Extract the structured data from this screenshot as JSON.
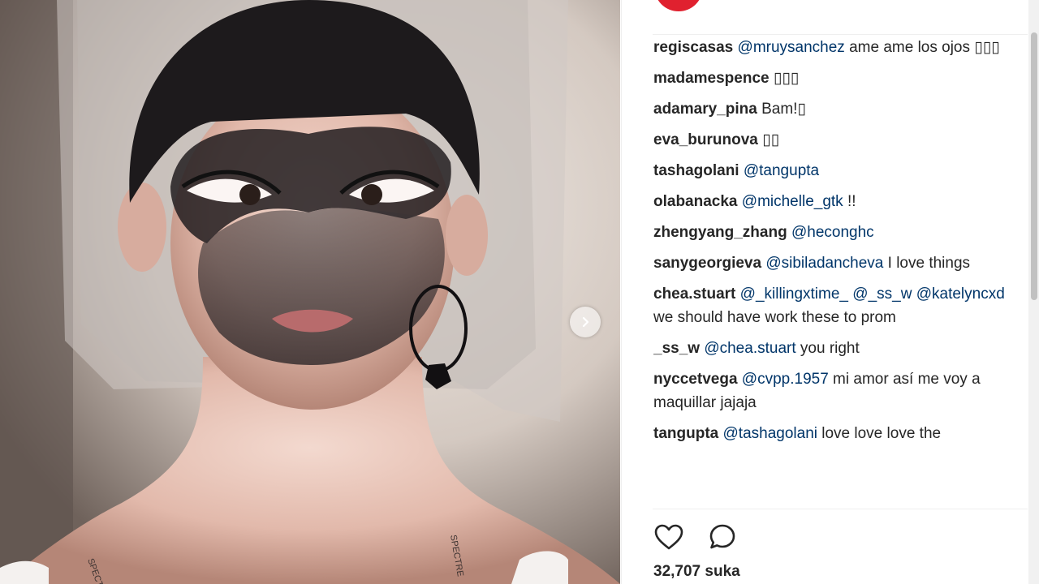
{
  "photo": {
    "alt_subject": "model-with-veil-mask",
    "next_icon": "chevron-right-icon"
  },
  "comments": [
    {
      "username": "regiscasas",
      "parts": [
        {
          "type": "mention",
          "text": "@mruysanchez"
        },
        {
          "type": "text",
          "text": " ame ame los ojos ▯▯▯"
        }
      ]
    },
    {
      "username": "madamespence",
      "parts": [
        {
          "type": "text",
          "text": "▯▯▯"
        }
      ]
    },
    {
      "username": "adamary_pina",
      "parts": [
        {
          "type": "text",
          "text": "Bam!▯"
        }
      ]
    },
    {
      "username": "eva_burunova",
      "parts": [
        {
          "type": "text",
          "text": "▯▯"
        }
      ]
    },
    {
      "username": "tashagolani",
      "parts": [
        {
          "type": "mention",
          "text": "@tangupta"
        }
      ]
    },
    {
      "username": "olabanacka",
      "parts": [
        {
          "type": "mention",
          "text": "@michelle_gtk"
        },
        {
          "type": "text",
          "text": " !!"
        }
      ]
    },
    {
      "username": "zhengyang_zhang",
      "parts": [
        {
          "type": "mention",
          "text": "@hecongh​c"
        }
      ]
    },
    {
      "username": "sanygeorgieva",
      "parts": [
        {
          "type": "mention",
          "text": "@sibiladancheva"
        },
        {
          "type": "text",
          "text": " I love things"
        }
      ]
    },
    {
      "username": "chea.stuart",
      "parts": [
        {
          "type": "mention",
          "text": "@_killingxtime_"
        },
        {
          "type": "text",
          "text": " "
        },
        {
          "type": "mention",
          "text": "@_ss_w"
        },
        {
          "type": "text",
          "text": " "
        },
        {
          "type": "mention",
          "text": "@katelyncxd"
        },
        {
          "type": "text",
          "text": " we should have work these to prom"
        }
      ]
    },
    {
      "username": "_ss_w",
      "parts": [
        {
          "type": "mention",
          "text": "@chea.stuart"
        },
        {
          "type": "text",
          "text": " you right"
        }
      ]
    },
    {
      "username": "nyccetvega",
      "parts": [
        {
          "type": "mention",
          "text": "@cvpp.1957"
        },
        {
          "type": "text",
          "text": " mi amor así me voy a maquillar jajaja"
        }
      ]
    },
    {
      "username": "tangupta",
      "parts": [
        {
          "type": "mention",
          "text": "@tashagolani"
        },
        {
          "type": "text",
          "text": " love love love the"
        }
      ]
    }
  ],
  "actions": {
    "like_icon": "heart-icon",
    "comment_icon": "comment-bubble-icon"
  },
  "likes": {
    "text": "32,707 suka"
  },
  "colors": {
    "mention": "#003569",
    "text": "#262626",
    "brand_avatar": "#e0212f"
  }
}
